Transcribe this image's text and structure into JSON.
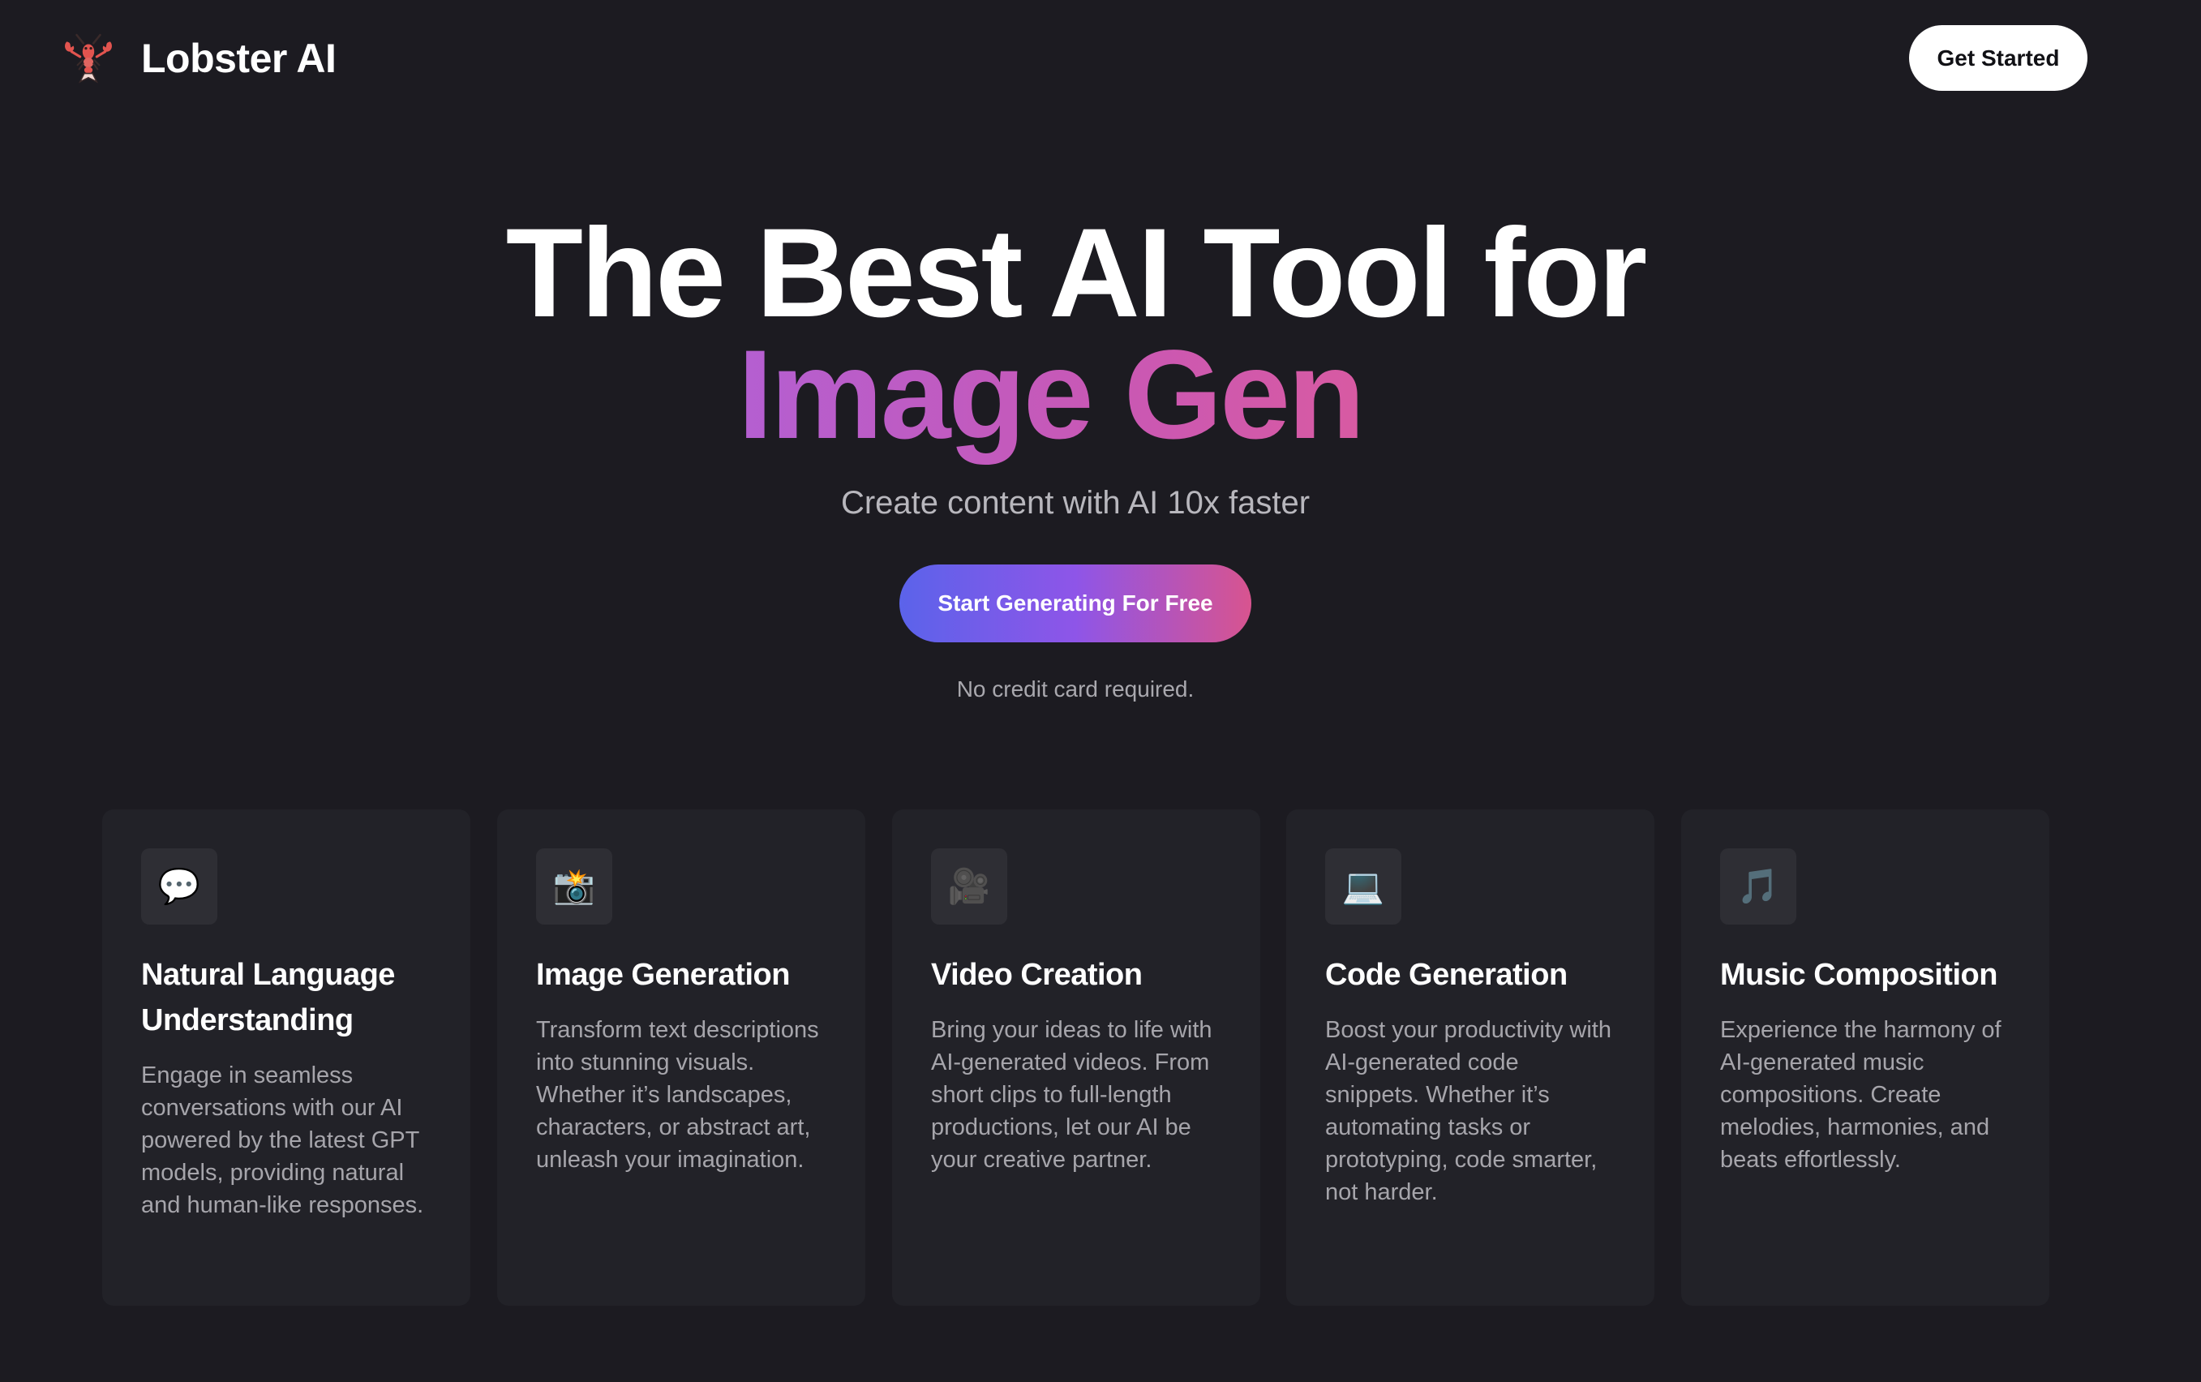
{
  "nav": {
    "brand_name": "Lobster AI",
    "logo_icon": "lobster-icon",
    "cta_label": "Get Started"
  },
  "hero": {
    "title_line1": "The Best AI Tool for",
    "title_line2": "Image Gen",
    "subtitle": "Create content with AI 10x faster",
    "cta_label": "Start Generating For Free",
    "note": "No credit card required."
  },
  "colors": {
    "background": "#1c1b21",
    "card": "#222228",
    "accent_gradient_start": "#5b63ea",
    "accent_gradient_end": "#d8548f",
    "title_accent": "#c25bbf"
  },
  "features": [
    {
      "icon": "speech-bubble-icon",
      "glyph": "💬",
      "title": "Natural Language Understanding",
      "description": "Engage in seamless conversations with our AI powered by the latest GPT models, providing natural and human-like responses."
    },
    {
      "icon": "camera-flash-icon",
      "glyph": "📸",
      "title": "Image Generation",
      "description": "Transform text descriptions into stunning visuals. Whether it’s landscapes, characters, or abstract art, unleash your imagination."
    },
    {
      "icon": "video-camera-icon",
      "glyph": "🎥",
      "title": "Video Creation",
      "description": "Bring your ideas to life with AI-generated videos. From short clips to full-length productions, let our AI be your creative partner."
    },
    {
      "icon": "laptop-icon",
      "glyph": "💻",
      "title": "Code Generation",
      "description": "Boost your productivity with AI-generated code snippets. Whether it’s automating tasks or prototyping, code smarter, not harder."
    },
    {
      "icon": "music-notes-icon",
      "glyph": "🎵",
      "title": "Music Composition",
      "description": "Experience the harmony of AI-generated music compositions. Create melodies, harmonies, and beats effortlessly."
    }
  ]
}
